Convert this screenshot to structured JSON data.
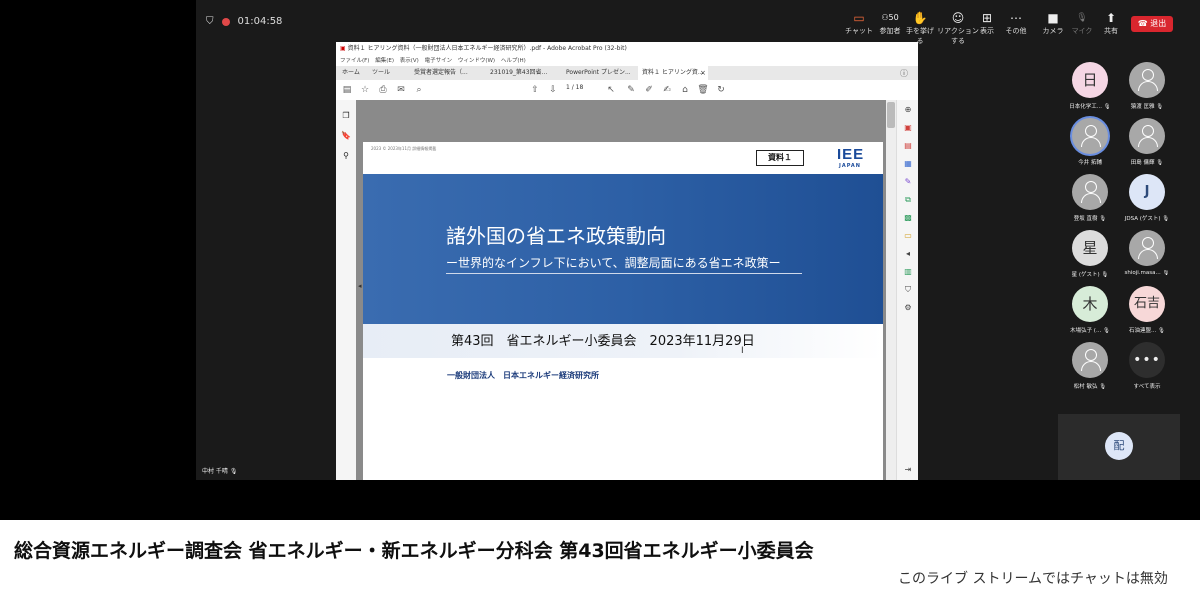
{
  "topbar": {
    "timer": "01:04:58",
    "buttons": [
      {
        "icon": "chat-icon",
        "glyph": "▭",
        "label": "チャット"
      },
      {
        "icon": "participants-icon",
        "glyph": "⚇50",
        "label": "参加者"
      },
      {
        "icon": "raise-hand-icon",
        "glyph": "✋",
        "label": "手を挙げる"
      },
      {
        "icon": "reaction-icon",
        "glyph": "☺",
        "label": "リアクションする"
      },
      {
        "icon": "view-icon",
        "glyph": "⊞",
        "label": "表示"
      },
      {
        "icon": "more-icon",
        "glyph": "⋯",
        "label": "その他"
      },
      {
        "icon": "camera-icon",
        "glyph": "■",
        "label": "カメラ"
      },
      {
        "icon": "mic-off-icon",
        "glyph": "🎙",
        "label": "マイク"
      },
      {
        "icon": "share-icon",
        "glyph": "⬆",
        "label": "共有"
      }
    ],
    "leave_label": "退出"
  },
  "acrobat": {
    "title": "資料１ ヒアリング資料（一般財団法人日本エネルギー経済研究所）.pdf - Adobe Acrobat Pro (32-bit)",
    "menu": [
      "ファイル(F)",
      "編集(E)",
      "表示(V)",
      "電子サイン",
      "ウィンドウ(W)",
      "ヘルプ(H)"
    ],
    "tabs": [
      "ホーム",
      "ツール",
      "受賞者選定報告（...",
      "231019_第43回省...",
      "PowerPoint プレゼン...",
      "資料１ ヒアリング資..."
    ],
    "page_current": "1",
    "page_total": "/ 18"
  },
  "slide": {
    "header_small": "2023 © 2023年11月 詳細情報掲載",
    "tag": "資料１",
    "logo": "IEE",
    "logo_sub": "JAPAN",
    "title": "諸外国の省エネ政策動向",
    "subtitle": "ー世界的なインフレ下において、調整局面にある省エネ政策ー",
    "meeting_date": "第43回　省エネルギー小委員会　2023年11月29日",
    "organization": "一般財団法人　日本エネルギー経済研究所"
  },
  "speaker_name": "中村 千晴",
  "participants": [
    {
      "initial": "日",
      "name": "日本化学工...",
      "style": "pink"
    },
    {
      "initial": "",
      "name": "猿渡 匡雅",
      "style": "default"
    },
    {
      "initial": "",
      "name": "今井 拓輔",
      "style": "default"
    },
    {
      "initial": "",
      "name": "田島 傭輝",
      "style": "default"
    },
    {
      "initial": "",
      "name": "登坂 直樹",
      "style": "default"
    },
    {
      "initial": "J",
      "name": "JDSA (ゲスト)",
      "style": "blue"
    },
    {
      "initial": "星",
      "name": "星 (ゲスト)",
      "style": "gray"
    },
    {
      "initial": "",
      "name": "shioji.masa...",
      "style": "default"
    },
    {
      "initial": "木",
      "name": "木場弘子 (...",
      "style": "green"
    },
    {
      "initial": "石吉",
      "name": "石油連盟...",
      "style": "salmon"
    },
    {
      "initial": "",
      "name": "松村 敏弘",
      "style": "default"
    },
    {
      "initial": "•••",
      "name": "すべて表示",
      "style": "dark"
    }
  ],
  "bottom_avatar": "配",
  "page": {
    "video_title": "総合資源エネルギー調査会 省エネルギー・新エネルギー分科会 第43回省エネルギー小委員会",
    "chat_notice": "このライブ ストリームではチャットは無効"
  }
}
